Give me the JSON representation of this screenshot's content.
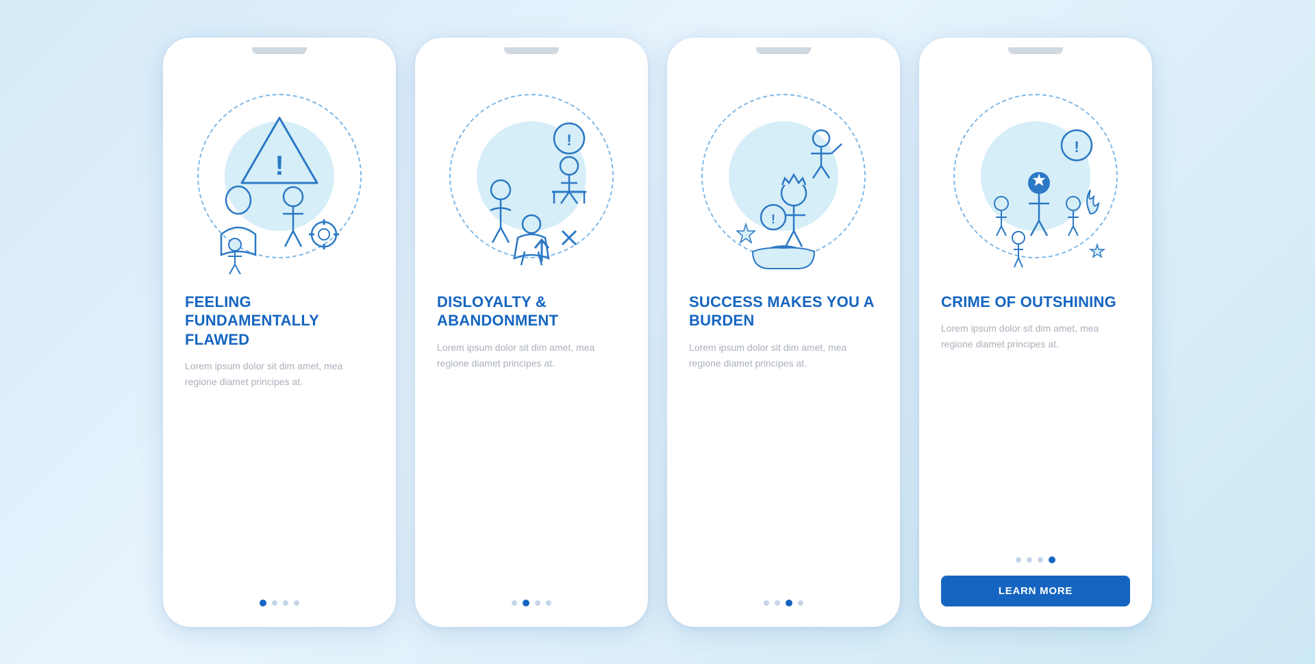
{
  "background": "#d6eaf8",
  "cards": [
    {
      "id": "card-1",
      "title": "FEELING FUNDAMENTALLY FLAWED",
      "body": "Lorem ipsum dolor sit dim amet, mea regione diamet principes at.",
      "dots": [
        true,
        false,
        false,
        false
      ],
      "show_button": false,
      "button_label": ""
    },
    {
      "id": "card-2",
      "title": "DISLOYALTY & ABANDONMENT",
      "body": "Lorem ipsum dolor sit dim amet, mea regione diamet principes at.",
      "dots": [
        false,
        true,
        false,
        false
      ],
      "show_button": false,
      "button_label": ""
    },
    {
      "id": "card-3",
      "title": "SUCCESS MAKES YOU A BURDEN",
      "body": "Lorem ipsum dolor sit dim amet, mea regione diamet principes at.",
      "dots": [
        false,
        false,
        true,
        false
      ],
      "show_button": false,
      "button_label": ""
    },
    {
      "id": "card-4",
      "title": "CRIME OF OUTSHINING",
      "body": "Lorem ipsum dolor sit dim amet, mea regione diamet principes at.",
      "dots": [
        false,
        false,
        false,
        true
      ],
      "show_button": true,
      "button_label": "LEARN MORE"
    }
  ],
  "colors": {
    "primary_blue": "#1565c0",
    "light_blue": "#5b9bd5",
    "pale_blue": "#d6eef8",
    "icon_blue": "#2b78c5",
    "dot_inactive": "#c5d5e8"
  }
}
